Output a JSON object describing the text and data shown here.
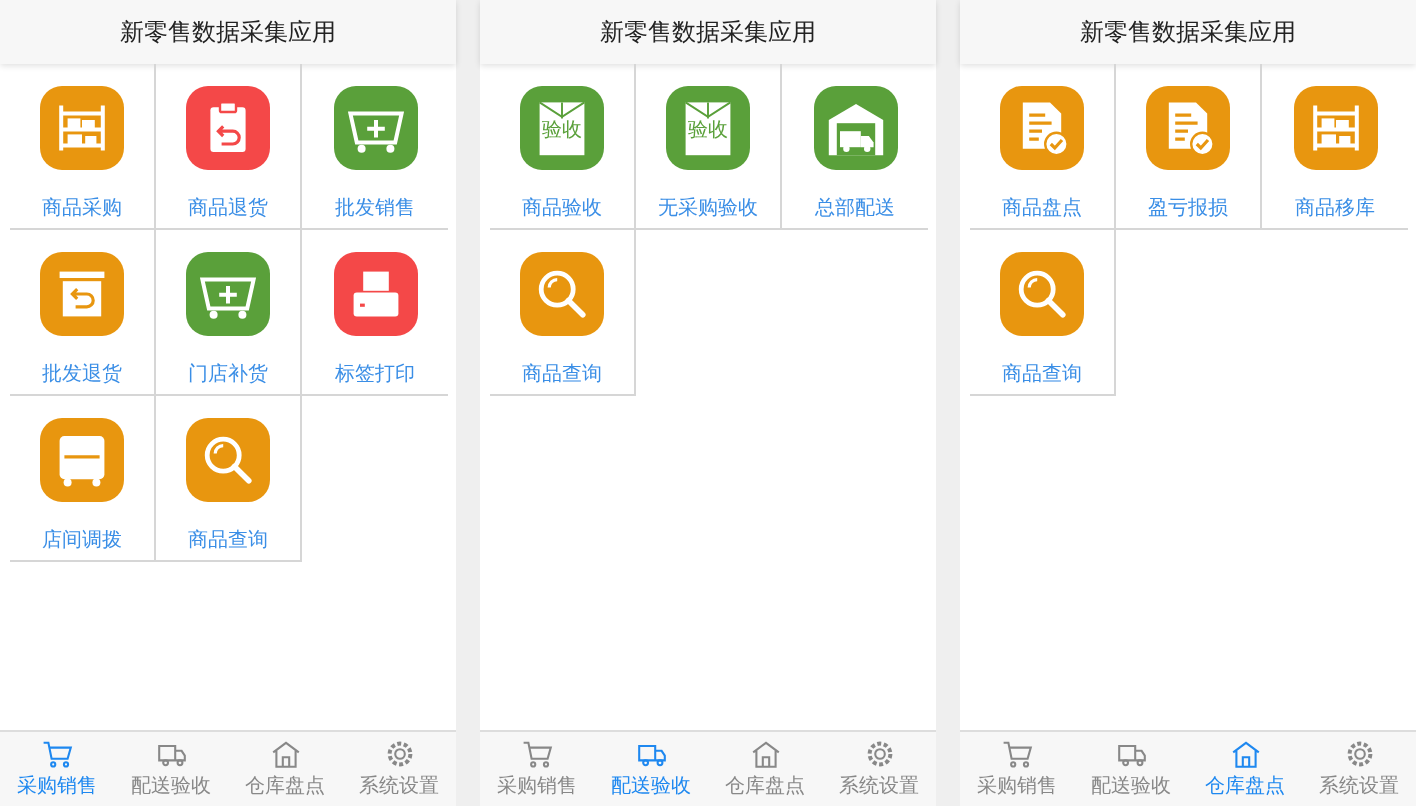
{
  "screens": [
    {
      "title": "新零售数据采集应用",
      "items": [
        {
          "label": "商品采购",
          "color": "#e8960f"
        },
        {
          "label": "商品退货",
          "color": "#f44848"
        },
        {
          "label": "批发销售",
          "color": "#5aa03a"
        },
        {
          "label": "批发退货",
          "color": "#e8960f"
        },
        {
          "label": "门店补货",
          "color": "#5aa03a"
        },
        {
          "label": "标签打印",
          "color": "#f44848"
        },
        {
          "label": "店间调拨",
          "color": "#e8960f"
        },
        {
          "label": "商品查询",
          "color": "#e8960f"
        }
      ],
      "tabs": [
        {
          "label": "采购销售",
          "selected": true
        },
        {
          "label": "配送验收",
          "selected": false
        },
        {
          "label": "仓库盘点",
          "selected": false
        },
        {
          "label": "系统设置",
          "selected": false
        }
      ]
    },
    {
      "title": "新零售数据采集应用",
      "items": [
        {
          "label": "商品验收",
          "color": "#5aa03a",
          "icon_text": "验收"
        },
        {
          "label": "无采购验收",
          "color": "#5aa03a",
          "icon_text": "验收"
        },
        {
          "label": "总部配送",
          "color": "#5aa03a"
        },
        {
          "label": "商品查询",
          "color": "#e8960f"
        }
      ],
      "tabs": [
        {
          "label": "采购销售",
          "selected": false
        },
        {
          "label": "配送验收",
          "selected": true
        },
        {
          "label": "仓库盘点",
          "selected": false
        },
        {
          "label": "系统设置",
          "selected": false
        }
      ]
    },
    {
      "title": "新零售数据采集应用",
      "items": [
        {
          "label": "商品盘点",
          "color": "#e8960f"
        },
        {
          "label": "盈亏报损",
          "color": "#e8960f"
        },
        {
          "label": "商品移库",
          "color": "#e8960f"
        },
        {
          "label": "商品查询",
          "color": "#e8960f"
        }
      ],
      "tabs": [
        {
          "label": "采购销售",
          "selected": false
        },
        {
          "label": "配送验收",
          "selected": false
        },
        {
          "label": "仓库盘点",
          "selected": true
        },
        {
          "label": "系统设置",
          "selected": false
        }
      ]
    }
  ]
}
